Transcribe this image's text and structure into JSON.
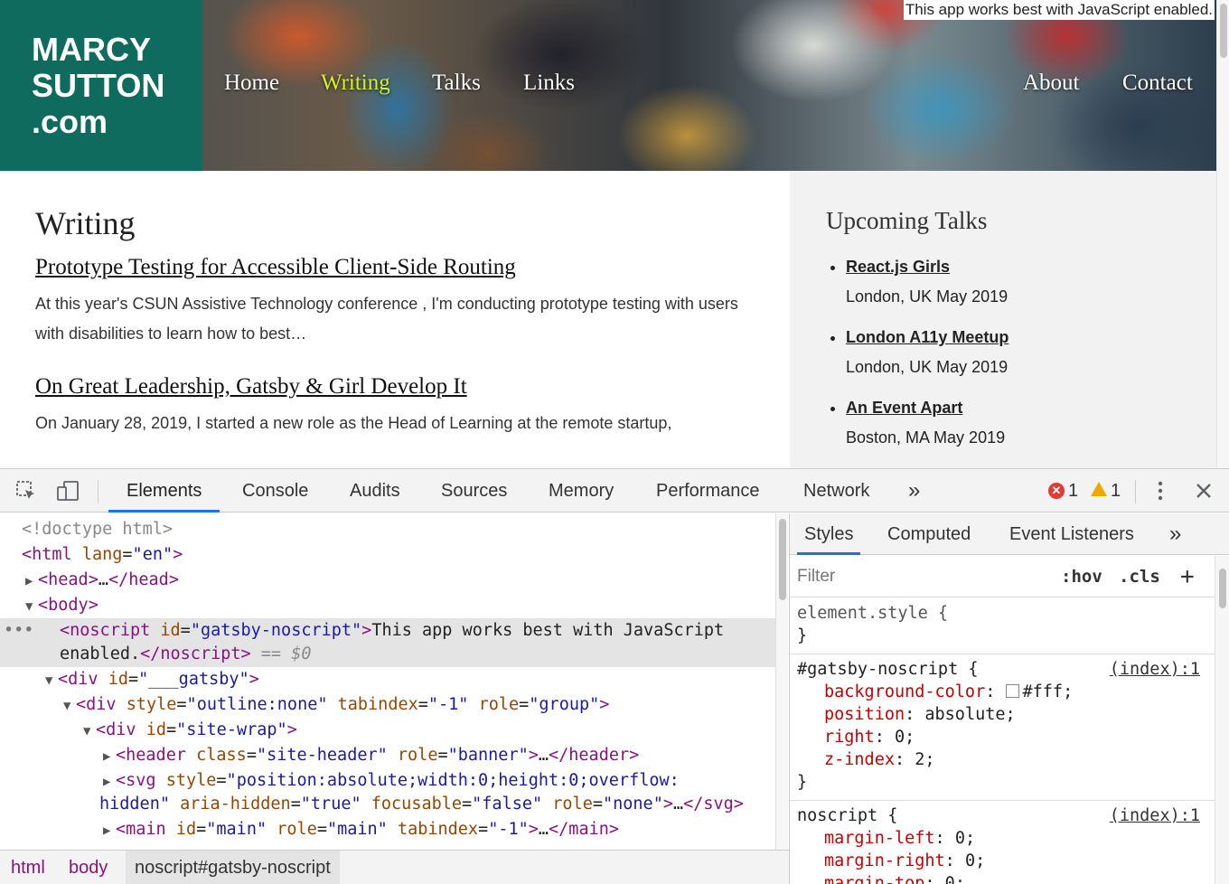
{
  "site": {
    "logo_lines": [
      "MARCY",
      "SUTTON",
      ".com"
    ],
    "nav": [
      "Home",
      "Writing",
      "Talks",
      "Links",
      "About",
      "Contact"
    ],
    "noscript_message": "This app works best with JavaScript enabled.",
    "page_heading": "Writing",
    "posts": [
      {
        "title": "Prototype Testing for Accessible Client-Side Routing",
        "excerpt": "At this year's CSUN Assistive Technology conference , I'm conducting prototype testing with users with disabilities to learn how to best…"
      },
      {
        "title": "On Great Leadership, Gatsby & Girl Develop It",
        "excerpt": "On January 28, 2019, I started a new role as the Head of Learning at the remote startup,"
      }
    ],
    "sidebar": {
      "heading": "Upcoming Talks",
      "talks": [
        {
          "name": "React.js Girls",
          "detail": "London, UK May 2019"
        },
        {
          "name": "London A11y Meetup",
          "detail": "London, UK May 2019"
        },
        {
          "name": "An Event Apart",
          "detail": "Boston, MA May 2019"
        }
      ]
    },
    "colors": {
      "logo_bg": "#0e6b5e",
      "nav_active": "#d4f12a",
      "sidebar_bg": "#f2f2f2"
    }
  },
  "devtools": {
    "tabs": [
      "Elements",
      "Console",
      "Audits",
      "Sources",
      "Memory",
      "Performance",
      "Network"
    ],
    "more_tabs": "»",
    "error_count": "1",
    "warning_count": "1",
    "icons": [
      "inspect-element-icon",
      "device-toolbar-icon",
      "error-icon",
      "warning-icon",
      "kebab-menu-icon",
      "close-icon"
    ],
    "dom": {
      "doctype": "<!doctype html>",
      "html_tag": "html",
      "html_attr": "lang",
      "html_attr_val": "en",
      "head_tag": "head",
      "body_tag": "body",
      "noscript_tag": "noscript",
      "noscript_id": "gatsby-noscript",
      "noscript_text_1": "This app works best with JavaScript",
      "noscript_text_2": "enabled.",
      "dollar_zero": "== $0",
      "div1_id": "___gatsby",
      "div2_style": "outline:none",
      "div2_tabindex": "-1",
      "div2_role": "group",
      "div3_id": "site-wrap",
      "header_class": "site-header",
      "header_role": "banner",
      "svg_style_1": "position:absolute;width:0;height:0;overflow:",
      "svg_style_2": "hidden",
      "svg_aria_hidden": "true",
      "svg_focusable": "false",
      "svg_role": "none",
      "main_id": "main",
      "main_role": "main",
      "main_tabindex": "-1"
    },
    "breadcrumbs": [
      "html",
      "body",
      "noscript#gatsby-noscript"
    ],
    "styles": {
      "tabs": [
        "Styles",
        "Computed",
        "Event Listeners"
      ],
      "filter_placeholder": "Filter",
      "hov": ":hov",
      "cls": ".cls",
      "rules": [
        {
          "selector": "element.style {",
          "props": []
        },
        {
          "selector": "#gatsby-noscript {",
          "source": "(index):1",
          "props": [
            [
              "background-color",
              "#fff"
            ],
            [
              "position",
              "absolute"
            ],
            [
              "right",
              "0"
            ],
            [
              "z-index",
              "2"
            ]
          ]
        },
        {
          "selector": "noscript {",
          "source": "(index):1",
          "props": [
            [
              "margin-left",
              "0"
            ],
            [
              "margin-right",
              "0"
            ],
            [
              "margin-top",
              "0"
            ]
          ]
        }
      ]
    }
  }
}
